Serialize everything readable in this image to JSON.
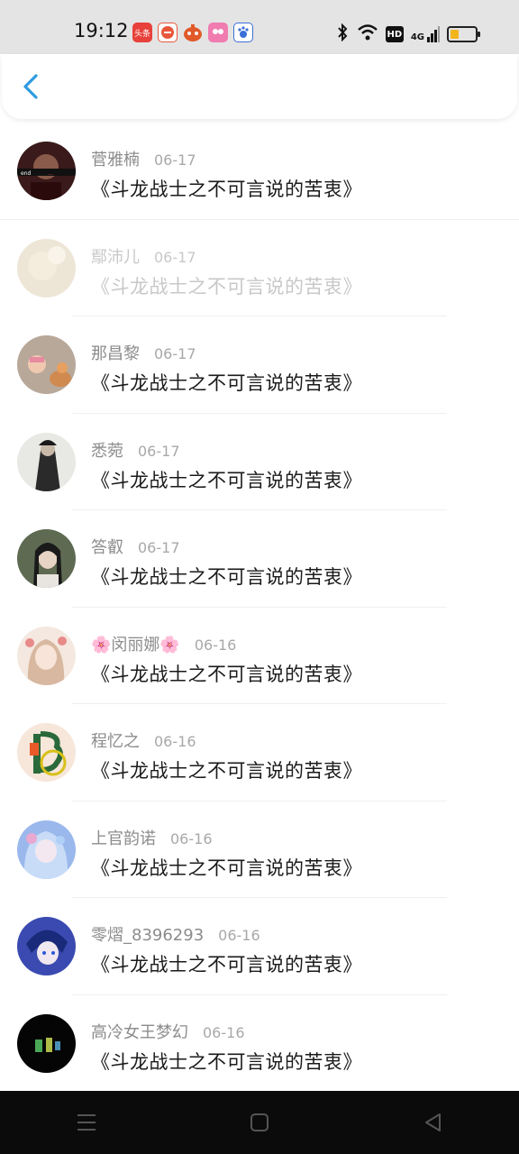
{
  "status_bar": {
    "time": "19:12",
    "notifications": [
      {
        "icon": "toutiao-app-icon",
        "label": "头条",
        "color": "#e8403a"
      },
      {
        "icon": "shopping-app-icon",
        "label": "",
        "color": "#e8573a"
      },
      {
        "icon": "game-app-icon",
        "label": "",
        "color": "#e05a2a"
      },
      {
        "icon": "camera-app-icon",
        "label": "",
        "color": "#f07cb0"
      },
      {
        "icon": "baidu-app-icon",
        "label": "",
        "color": "#3b6fd8"
      }
    ],
    "hd_label": "HD",
    "network_label": "4G",
    "battery_level": 0.35
  },
  "header": {
    "back_label": "back"
  },
  "items": [
    {
      "name": "菅雅楠",
      "date": "06-17",
      "title": "《斗龙战士之不可言说的苦衷》",
      "avatar_color": "#3a1a1a"
    },
    {
      "name": "鄢沛儿",
      "date": "06-17",
      "title": "《斗龙战士之不可言说的苦衷》",
      "avatar_color": "#d8c8a8"
    },
    {
      "name": "那昌黎",
      "date": "06-17",
      "title": "《斗龙战士之不可言说的苦衷》",
      "avatar_color": "#c9a48a"
    },
    {
      "name": "悉菀",
      "date": "06-17",
      "title": "《斗龙战士之不可言说的苦衷》",
      "avatar_color": "#9aa09a"
    },
    {
      "name": "答叡",
      "date": "06-17",
      "title": "《斗龙战士之不可言说的苦衷》",
      "avatar_color": "#4e5a44"
    },
    {
      "name": "🌸闵丽娜🌸",
      "date": "06-16",
      "title": "《斗龙战士之不可言说的苦衷》",
      "avatar_color": "#e8cfc0"
    },
    {
      "name": "程忆之",
      "date": "06-16",
      "title": "《斗龙战士之不可言说的苦衷》",
      "avatar_color": "#f5e0d0"
    },
    {
      "name": "上官韵诺",
      "date": "06-16",
      "title": "《斗龙战士之不可言说的苦衷》",
      "avatar_color": "#7fa7e0"
    },
    {
      "name": "零熠_8396293",
      "date": "06-16",
      "title": "《斗龙战士之不可言说的苦衷》",
      "avatar_color": "#2a3a8a"
    },
    {
      "name": "高冷女王梦幻",
      "date": "06-16",
      "title": "《斗龙战士之不可言说的苦衷》",
      "avatar_color": "#0a0a0a"
    }
  ],
  "nav": {
    "menu_icon": "menu-icon",
    "home_icon": "home-icon",
    "back_icon": "back-triangle-icon"
  }
}
